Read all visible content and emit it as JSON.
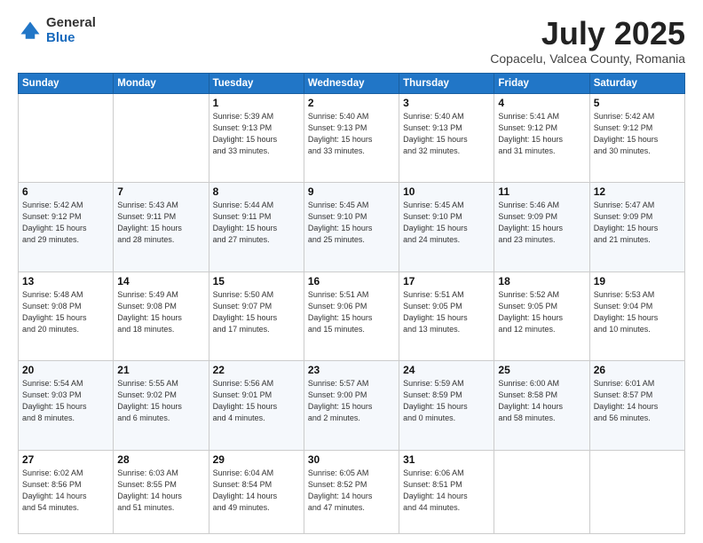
{
  "logo": {
    "general": "General",
    "blue": "Blue"
  },
  "header": {
    "month": "July 2025",
    "location": "Copacelu, Valcea County, Romania"
  },
  "weekdays": [
    "Sunday",
    "Monday",
    "Tuesday",
    "Wednesday",
    "Thursday",
    "Friday",
    "Saturday"
  ],
  "weeks": [
    [
      {
        "day": "",
        "info": ""
      },
      {
        "day": "",
        "info": ""
      },
      {
        "day": "1",
        "info": "Sunrise: 5:39 AM\nSunset: 9:13 PM\nDaylight: 15 hours\nand 33 minutes."
      },
      {
        "day": "2",
        "info": "Sunrise: 5:40 AM\nSunset: 9:13 PM\nDaylight: 15 hours\nand 33 minutes."
      },
      {
        "day": "3",
        "info": "Sunrise: 5:40 AM\nSunset: 9:13 PM\nDaylight: 15 hours\nand 32 minutes."
      },
      {
        "day": "4",
        "info": "Sunrise: 5:41 AM\nSunset: 9:12 PM\nDaylight: 15 hours\nand 31 minutes."
      },
      {
        "day": "5",
        "info": "Sunrise: 5:42 AM\nSunset: 9:12 PM\nDaylight: 15 hours\nand 30 minutes."
      }
    ],
    [
      {
        "day": "6",
        "info": "Sunrise: 5:42 AM\nSunset: 9:12 PM\nDaylight: 15 hours\nand 29 minutes."
      },
      {
        "day": "7",
        "info": "Sunrise: 5:43 AM\nSunset: 9:11 PM\nDaylight: 15 hours\nand 28 minutes."
      },
      {
        "day": "8",
        "info": "Sunrise: 5:44 AM\nSunset: 9:11 PM\nDaylight: 15 hours\nand 27 minutes."
      },
      {
        "day": "9",
        "info": "Sunrise: 5:45 AM\nSunset: 9:10 PM\nDaylight: 15 hours\nand 25 minutes."
      },
      {
        "day": "10",
        "info": "Sunrise: 5:45 AM\nSunset: 9:10 PM\nDaylight: 15 hours\nand 24 minutes."
      },
      {
        "day": "11",
        "info": "Sunrise: 5:46 AM\nSunset: 9:09 PM\nDaylight: 15 hours\nand 23 minutes."
      },
      {
        "day": "12",
        "info": "Sunrise: 5:47 AM\nSunset: 9:09 PM\nDaylight: 15 hours\nand 21 minutes."
      }
    ],
    [
      {
        "day": "13",
        "info": "Sunrise: 5:48 AM\nSunset: 9:08 PM\nDaylight: 15 hours\nand 20 minutes."
      },
      {
        "day": "14",
        "info": "Sunrise: 5:49 AM\nSunset: 9:08 PM\nDaylight: 15 hours\nand 18 minutes."
      },
      {
        "day": "15",
        "info": "Sunrise: 5:50 AM\nSunset: 9:07 PM\nDaylight: 15 hours\nand 17 minutes."
      },
      {
        "day": "16",
        "info": "Sunrise: 5:51 AM\nSunset: 9:06 PM\nDaylight: 15 hours\nand 15 minutes."
      },
      {
        "day": "17",
        "info": "Sunrise: 5:51 AM\nSunset: 9:05 PM\nDaylight: 15 hours\nand 13 minutes."
      },
      {
        "day": "18",
        "info": "Sunrise: 5:52 AM\nSunset: 9:05 PM\nDaylight: 15 hours\nand 12 minutes."
      },
      {
        "day": "19",
        "info": "Sunrise: 5:53 AM\nSunset: 9:04 PM\nDaylight: 15 hours\nand 10 minutes."
      }
    ],
    [
      {
        "day": "20",
        "info": "Sunrise: 5:54 AM\nSunset: 9:03 PM\nDaylight: 15 hours\nand 8 minutes."
      },
      {
        "day": "21",
        "info": "Sunrise: 5:55 AM\nSunset: 9:02 PM\nDaylight: 15 hours\nand 6 minutes."
      },
      {
        "day": "22",
        "info": "Sunrise: 5:56 AM\nSunset: 9:01 PM\nDaylight: 15 hours\nand 4 minutes."
      },
      {
        "day": "23",
        "info": "Sunrise: 5:57 AM\nSunset: 9:00 PM\nDaylight: 15 hours\nand 2 minutes."
      },
      {
        "day": "24",
        "info": "Sunrise: 5:59 AM\nSunset: 8:59 PM\nDaylight: 15 hours\nand 0 minutes."
      },
      {
        "day": "25",
        "info": "Sunrise: 6:00 AM\nSunset: 8:58 PM\nDaylight: 14 hours\nand 58 minutes."
      },
      {
        "day": "26",
        "info": "Sunrise: 6:01 AM\nSunset: 8:57 PM\nDaylight: 14 hours\nand 56 minutes."
      }
    ],
    [
      {
        "day": "27",
        "info": "Sunrise: 6:02 AM\nSunset: 8:56 PM\nDaylight: 14 hours\nand 54 minutes."
      },
      {
        "day": "28",
        "info": "Sunrise: 6:03 AM\nSunset: 8:55 PM\nDaylight: 14 hours\nand 51 minutes."
      },
      {
        "day": "29",
        "info": "Sunrise: 6:04 AM\nSunset: 8:54 PM\nDaylight: 14 hours\nand 49 minutes."
      },
      {
        "day": "30",
        "info": "Sunrise: 6:05 AM\nSunset: 8:52 PM\nDaylight: 14 hours\nand 47 minutes."
      },
      {
        "day": "31",
        "info": "Sunrise: 6:06 AM\nSunset: 8:51 PM\nDaylight: 14 hours\nand 44 minutes."
      },
      {
        "day": "",
        "info": ""
      },
      {
        "day": "",
        "info": ""
      }
    ]
  ]
}
